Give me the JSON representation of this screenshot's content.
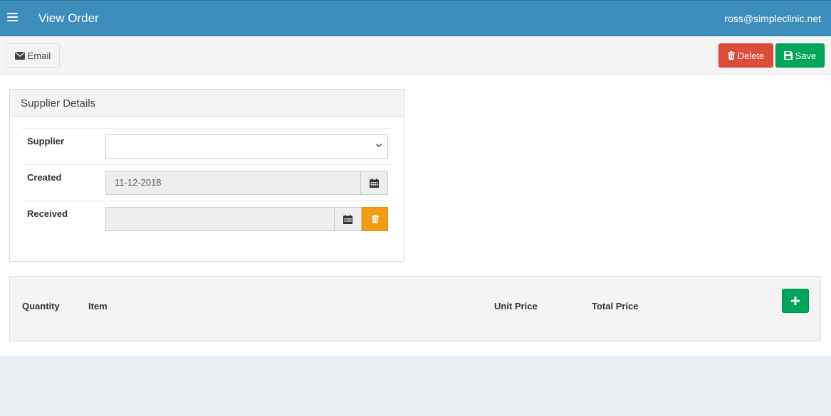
{
  "header": {
    "menu_icon": "hamburger-icon",
    "title": "View Order",
    "user_email": "ross@simpleclinic.net",
    "color": "#3c8dbc"
  },
  "toolbar": {
    "email_label": "Email",
    "email_icon": "envelope-icon",
    "delete_label": "Delete",
    "delete_icon": "trash-icon",
    "delete_color": "#dd4b39",
    "save_label": "Save",
    "save_icon": "floppy-disk-icon",
    "save_color": "#00a65a"
  },
  "supplier_details": {
    "title": "Supplier Details",
    "supplier": {
      "label": "Supplier",
      "value": ""
    },
    "created": {
      "label": "Created",
      "value": "11-12-2018",
      "icon": "calendar-icon"
    },
    "received": {
      "label": "Received",
      "value": "",
      "icon": "calendar-icon",
      "clear_icon": "trash-icon",
      "clear_color": "#f39c12"
    }
  },
  "items_table": {
    "columns": [
      "Quantity",
      "Item",
      "Unit Price",
      "Total Price"
    ],
    "add_icon": "plus-icon"
  }
}
